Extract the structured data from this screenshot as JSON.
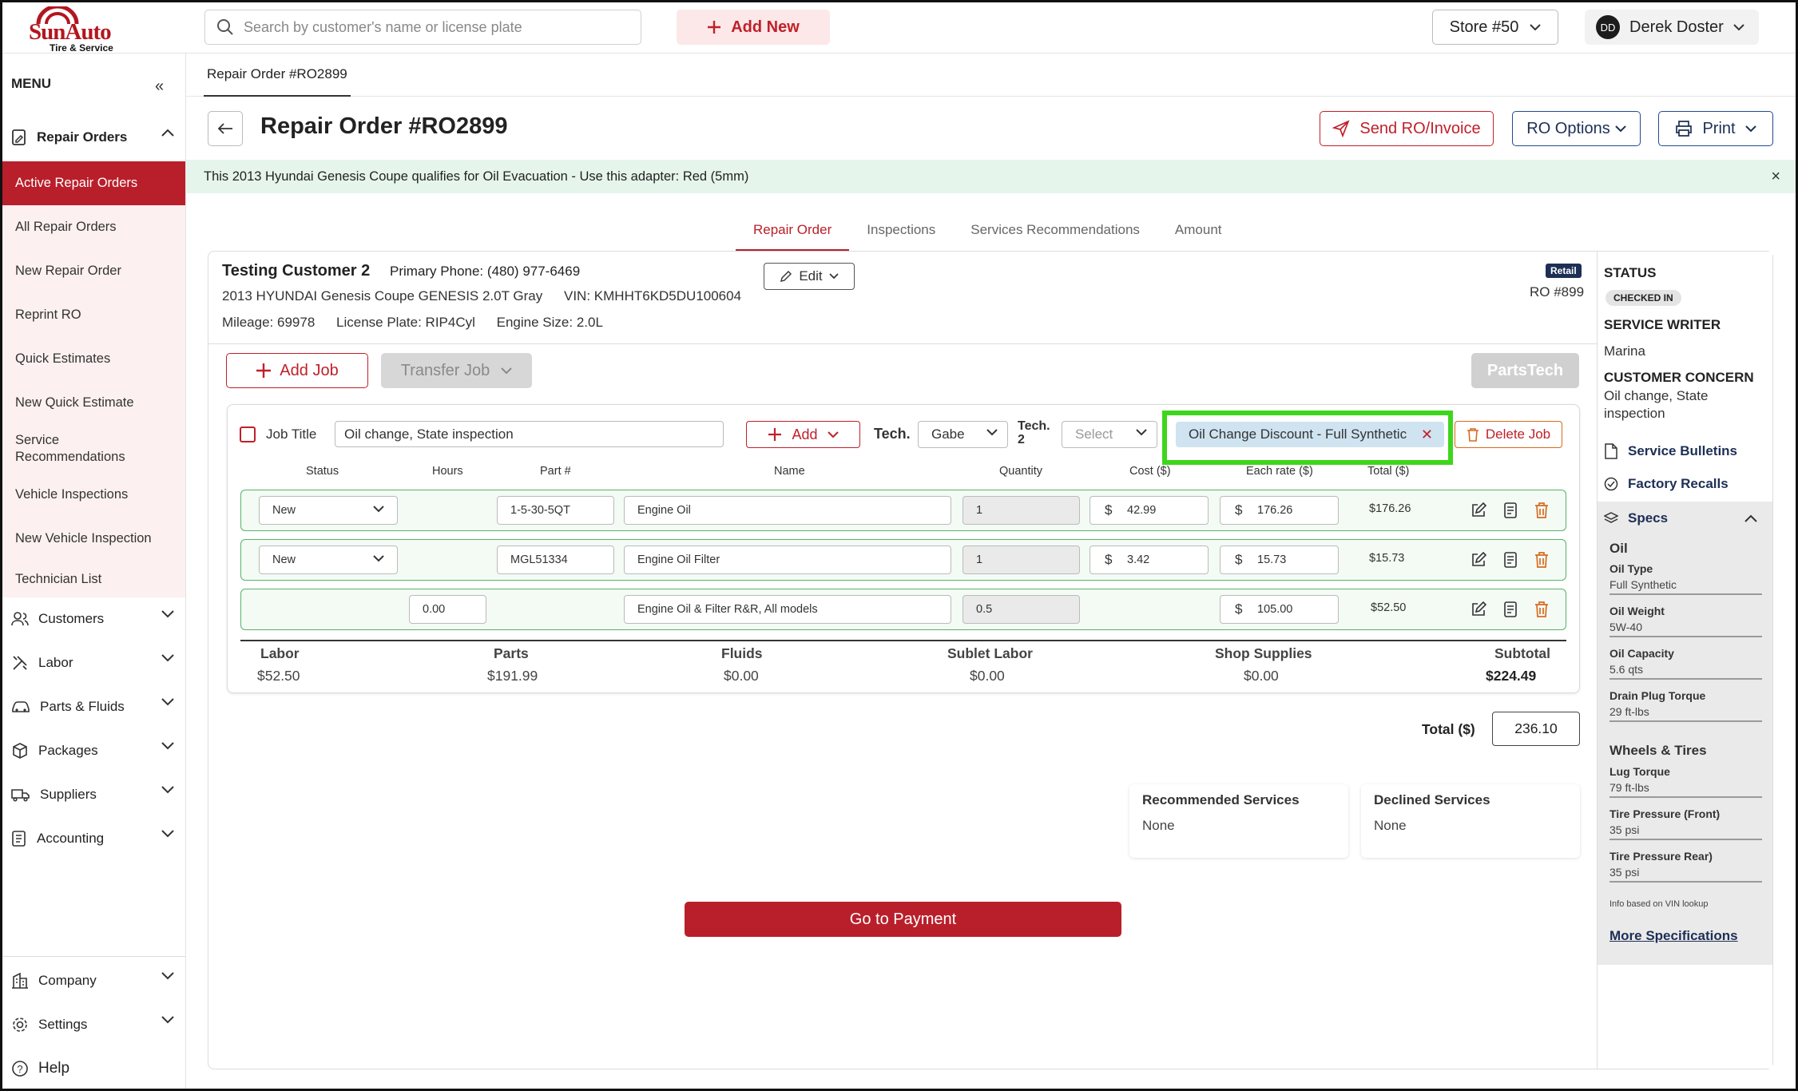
{
  "brand": {
    "name": "SunAuto",
    "tagline": "Tire & Service"
  },
  "header": {
    "search_placeholder": "Search by customer's name or license plate",
    "add_new": "Add New",
    "store": "Store #50",
    "user_initials": "DD",
    "user_name": "Derek Doster"
  },
  "sidebar": {
    "menu_label": "MENU",
    "repair_orders": "Repair Orders",
    "sub_items": [
      "Active Repair Orders",
      "All Repair Orders",
      "New Repair Order",
      "Reprint RO",
      "Quick Estimates",
      "New Quick Estimate",
      "Service Recommendations",
      "Vehicle Inspections",
      "New Vehicle Inspection",
      "Technician List"
    ],
    "groups": [
      "Customers",
      "Labor",
      "Parts & Fluids",
      "Packages",
      "Suppliers",
      "Accounting"
    ],
    "bottom": [
      "Company",
      "Settings",
      "Help"
    ]
  },
  "breadcrumb": "Repair Order #RO2899",
  "page": {
    "title": "Repair Order #RO2899",
    "send_btn": "Send RO/Invoice",
    "ro_options": "RO Options",
    "print": "Print",
    "banner": "This 2013 Hyundai Genesis Coupe qualifies for Oil Evacuation - Use this adapter: Red (5mm)",
    "banner_close": "×"
  },
  "tabs": [
    "Repair Order",
    "Inspections",
    "Services Recommendations",
    "Amount"
  ],
  "customer": {
    "name": "Testing Customer 2",
    "phone_label": "Primary Phone:",
    "phone": "(480) 977-6469",
    "vehicle": "2013 HYUNDAI Genesis Coupe GENESIS 2.0T Gray",
    "vin_label": "VIN:",
    "vin": "KMHHT6KD5DU100604",
    "mileage_label": "Mileage:",
    "mileage": "69978",
    "plate_label": "License Plate:",
    "plate": "RIP4Cyl",
    "engine_label": "Engine Size:",
    "engine": "2.0L",
    "edit": "Edit",
    "type_badge": "Retail",
    "ro_number": "RO #899"
  },
  "job_actions": {
    "add_job": "Add Job",
    "transfer_job": "Transfer Job",
    "partstech": "PartsTech"
  },
  "job": {
    "title_label": "Job Title",
    "title_value": "Oil change,  State inspection",
    "add": "Add",
    "tech_label": "Tech.",
    "tech_value": "Gabe",
    "tech2_label_1": "Tech.",
    "tech2_label_2": "2",
    "tech2_placeholder": "Select",
    "discount": "Oil Change Discount - Full Synthetic",
    "delete_job": "Delete Job",
    "columns": [
      "Status",
      "Hours",
      "Part #",
      "Name",
      "Quantity",
      "Cost ($)",
      "Each rate ($)",
      "Total ($)"
    ],
    "rows": [
      {
        "status": "New",
        "hours": "",
        "part": "1-5-30-5QT",
        "name": "Engine Oil",
        "qty": "1",
        "cost": "42.99",
        "rate": "176.26",
        "total": "$176.26"
      },
      {
        "status": "New",
        "hours": "",
        "part": "MGL51334",
        "name": "Engine Oil Filter",
        "qty": "1",
        "cost": "3.42",
        "rate": "15.73",
        "total": "$15.73"
      },
      {
        "status": "",
        "hours": "0.00",
        "part": "",
        "name": "Engine Oil & Filter R&R, All models",
        "qty": "0.5",
        "cost": "",
        "rate": "105.00",
        "total": "$52.50"
      }
    ],
    "summary": {
      "labor_label": "Labor",
      "labor": "$52.50",
      "parts_label": "Parts",
      "parts": "$191.99",
      "fluids_label": "Fluids",
      "fluids": "$0.00",
      "sublet_label": "Sublet Labor",
      "sublet": "$0.00",
      "shop_label": "Shop Supplies",
      "shop": "$0.00",
      "subtotal_label": "Subtotal",
      "subtotal": "$224.49"
    }
  },
  "total": {
    "label": "Total ($)",
    "value": "236.10"
  },
  "services": {
    "recommended_label": "Recommended Services",
    "recommended": "None",
    "declined_label": "Declined Services",
    "declined": "None"
  },
  "go_to_payment": "Go to Payment",
  "status_panel": {
    "status_label": "STATUS",
    "status": "CHECKED IN",
    "writer_label": "SERVICE WRITER",
    "writer": "Marina",
    "concern_label": "CUSTOMER CONCERN",
    "concern_1": "Oil change, State",
    "concern_2": "inspection",
    "bulletins": "Service Bulletins",
    "recalls": "Factory Recalls",
    "specs": "Specs",
    "oil_group": "Oil",
    "oil_specs": [
      {
        "k": "Oil Type",
        "v": "Full Synthetic"
      },
      {
        "k": "Oil Weight",
        "v": "5W-40"
      },
      {
        "k": "Oil Capacity",
        "v": "5.6 qts"
      },
      {
        "k": "Drain Plug Torque",
        "v": "29 ft-lbs"
      }
    ],
    "wheels_group": "Wheels & Tires",
    "wheel_specs": [
      {
        "k": "Lug Torque",
        "v": "79 ft-lbs"
      },
      {
        "k": "Tire Pressure (Front)",
        "v": "35 psi"
      },
      {
        "k": "Tire Pressure Rear)",
        "v": "35 psi"
      }
    ],
    "note": "Info based on VIN lookup",
    "more": "More Specifications"
  },
  "colors": {
    "brand_red": "#b91f2a",
    "highlight_green": "#3ed61c",
    "navy": "#1d2f55",
    "banner_green": "#e6f5ec"
  }
}
